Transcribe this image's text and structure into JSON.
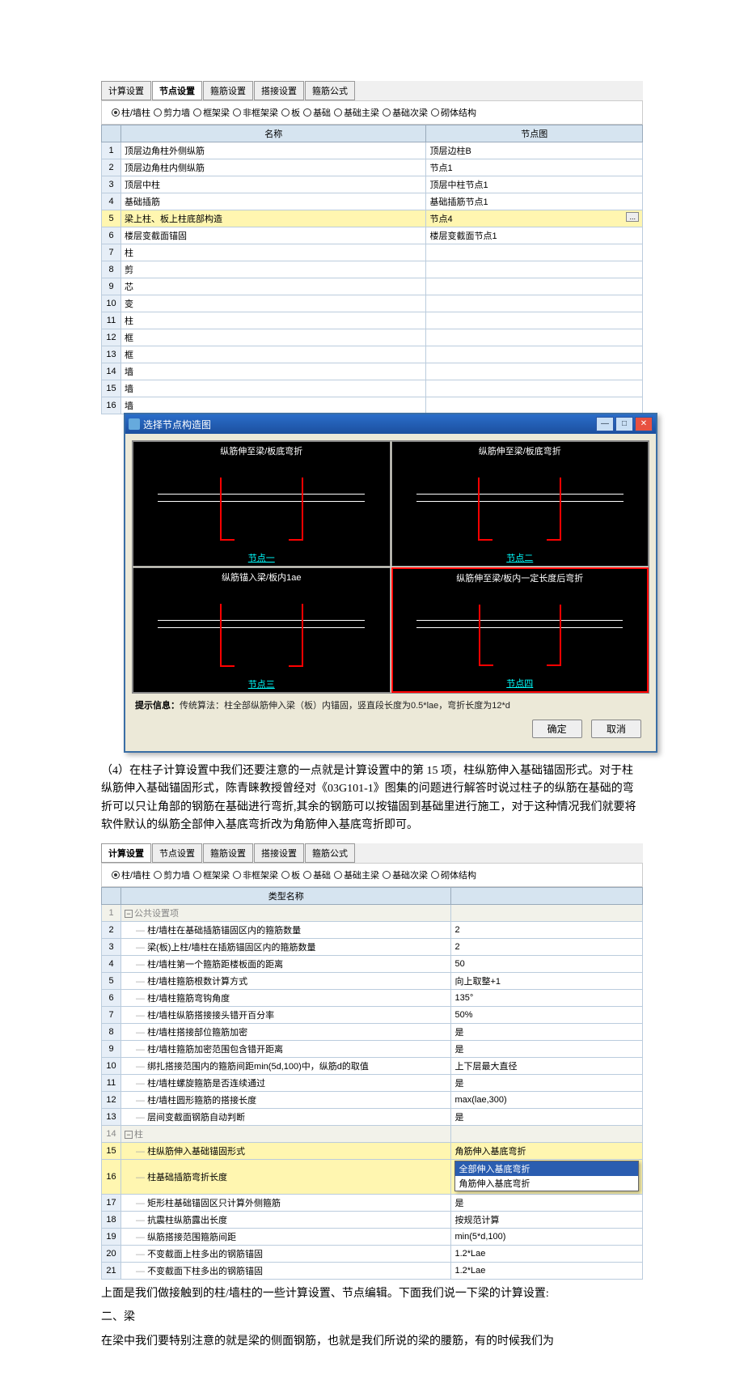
{
  "tabs1": [
    "计算设置",
    "节点设置",
    "箍筋设置",
    "搭接设置",
    "箍筋公式"
  ],
  "active_tab1": "节点设置",
  "radios1": [
    {
      "label": "柱/墙柱",
      "sel": true
    },
    {
      "label": "剪力墙",
      "sel": false
    },
    {
      "label": "框架梁",
      "sel": false
    },
    {
      "label": "非框架梁",
      "sel": false
    },
    {
      "label": "板",
      "sel": false
    },
    {
      "label": "基础",
      "sel": false
    },
    {
      "label": "基础主梁",
      "sel": false
    },
    {
      "label": "基础次梁",
      "sel": false
    },
    {
      "label": "砌体结构",
      "sel": false
    }
  ],
  "grid1_headers": [
    "",
    "名称",
    "节点图"
  ],
  "grid1_rows": [
    {
      "n": 1,
      "name": "顶层边角柱外侧纵筋",
      "node": "顶层边柱B"
    },
    {
      "n": 2,
      "name": "顶层边角柱内侧纵筋",
      "node": "节点1"
    },
    {
      "n": 3,
      "name": "顶层中柱",
      "node": "顶层中柱节点1"
    },
    {
      "n": 4,
      "name": "基础插筋",
      "node": "基础插筋节点1"
    },
    {
      "n": 5,
      "name": "梁上柱、板上柱底部构造",
      "node": "节点4",
      "sel": true,
      "btn": true
    },
    {
      "n": 6,
      "name": "楼层变截面锚固",
      "node": "楼层变截面节点1"
    },
    {
      "n": 7,
      "name": "柱"
    },
    {
      "n": 8,
      "name": "剪"
    },
    {
      "n": 9,
      "name": "芯"
    },
    {
      "n": 10,
      "name": "变"
    },
    {
      "n": 11,
      "name": "柱"
    },
    {
      "n": 12,
      "name": "框"
    },
    {
      "n": 13,
      "name": "框"
    },
    {
      "n": 14,
      "name": "墙"
    },
    {
      "n": 15,
      "name": "墙"
    },
    {
      "n": 16,
      "name": "墙"
    }
  ],
  "dialog": {
    "title": "选择节点构造图",
    "cells": [
      {
        "top": "纵筋伸至梁/板底弯折",
        "bot": "节点一"
      },
      {
        "top": "纵筋伸至梁/板底弯折",
        "bot": "节点二"
      },
      {
        "top": "纵筋锚入梁/板内1ae",
        "bot": "节点三"
      },
      {
        "top": "纵筋伸至梁/板内一定长度后弯折",
        "bot": "节点四",
        "sel": true
      }
    ],
    "hint_label": "提示信息：",
    "hint_text": "传统算法：柱全部纵筋伸入梁（板）内锚固，竖直段长度为0.5*lae，弯折长度为12*d",
    "ok": "确定",
    "cancel": "取消"
  },
  "paragraph1": "（4）在柱子计算设置中我们还要注意的一点就是计算设置中的第 15 项，柱纵筋伸入基础锚固形式。对于柱纵筋伸入基础锚固形式，陈青睐教授曾经对《03G101-1》图集的问题进行解答时说过柱子的纵筋在基础的弯折可以只让角部的钢筋在基础进行弯折,其余的钢筋可以按锚固到基础里进行施工，对于这种情况我们就要将软件默认的纵筋全部伸入基底弯折改为角筋伸入基底弯折即可。",
  "tabs2": [
    "计算设置",
    "节点设置",
    "箍筋设置",
    "搭接设置",
    "箍筋公式"
  ],
  "active_tab2": "计算设置",
  "radios2": [
    {
      "label": "柱/墙柱",
      "sel": true
    },
    {
      "label": "剪力墙",
      "sel": false
    },
    {
      "label": "框架梁",
      "sel": false
    },
    {
      "label": "非框架梁",
      "sel": false
    },
    {
      "label": "板",
      "sel": false
    },
    {
      "label": "基础",
      "sel": false
    },
    {
      "label": "基础主梁",
      "sel": false
    },
    {
      "label": "基础次梁",
      "sel": false
    },
    {
      "label": "砌体结构",
      "sel": false
    }
  ],
  "grid2_header": "类型名称",
  "grid2_rows": [
    {
      "n": "",
      "name": "",
      "val": "",
      "blankhead": true
    },
    {
      "n": 1,
      "name": "公共设置项",
      "group": true
    },
    {
      "n": 2,
      "name": "柱/墙柱在基础插筋锚固区内的箍筋数量",
      "val": "2"
    },
    {
      "n": 3,
      "name": "梁(板)上柱/墙柱在插筋锚固区内的箍筋数量",
      "val": "2"
    },
    {
      "n": 4,
      "name": "柱/墙柱第一个箍筋距楼板面的距离",
      "val": "50"
    },
    {
      "n": 5,
      "name": "柱/墙柱箍筋根数计算方式",
      "val": "向上取整+1"
    },
    {
      "n": 6,
      "name": "柱/墙柱箍筋弯钩角度",
      "val": "135°"
    },
    {
      "n": 7,
      "name": "柱/墙柱纵筋搭接接头错开百分率",
      "val": "50%"
    },
    {
      "n": 8,
      "name": "柱/墙柱搭接部位箍筋加密",
      "val": "是"
    },
    {
      "n": 9,
      "name": "柱/墙柱箍筋加密范围包含错开距离",
      "val": "是"
    },
    {
      "n": 10,
      "name": "绑扎搭接范围内的箍筋间距min(5d,100)中，纵筋d的取值",
      "val": "上下层最大直径"
    },
    {
      "n": 11,
      "name": "柱/墙柱螺旋箍筋是否连续通过",
      "val": "是"
    },
    {
      "n": 12,
      "name": "柱/墙柱圆形箍筋的搭接长度",
      "val": "max(lae,300)"
    },
    {
      "n": 13,
      "name": "层间变截面钢筋自动判断",
      "val": "是"
    },
    {
      "n": 14,
      "name": "柱",
      "group": true
    },
    {
      "n": 15,
      "name": "柱纵筋伸入基础锚固形式",
      "val": "角筋伸入基底弯折",
      "yellow": true
    },
    {
      "n": 16,
      "name": "柱基础插筋弯折长度",
      "val": "",
      "yellow": true,
      "dropdown": true
    },
    {
      "n": 17,
      "name": "矩形柱基础锚固区只计算外侧箍筋",
      "val": "是"
    },
    {
      "n": 18,
      "name": "抗震柱纵筋露出长度",
      "val": "按规范计算"
    },
    {
      "n": 19,
      "name": "纵筋搭接范围箍筋间距",
      "val": "min(5*d,100)"
    },
    {
      "n": 20,
      "name": "不变截面上柱多出的钢筋锚固",
      "val": "1.2*Lae"
    },
    {
      "n": 21,
      "name": "不变截面下柱多出的钢筋锚固",
      "val": "1.2*Lae"
    }
  ],
  "dropdown_options": [
    "全部伸入基底弯折",
    "角筋伸入基底弯折"
  ],
  "paragraph2a": "上面是我们做接触到的柱/墙柱的一些计算设置、节点编辑。下面我们说一下梁的计算设置:",
  "paragraph2b": "二、梁",
  "paragraph2c": "在梁中我们要特别注意的就是梁的侧面钢筋，也就是我们所说的梁的腰筋，有的时候我们为"
}
